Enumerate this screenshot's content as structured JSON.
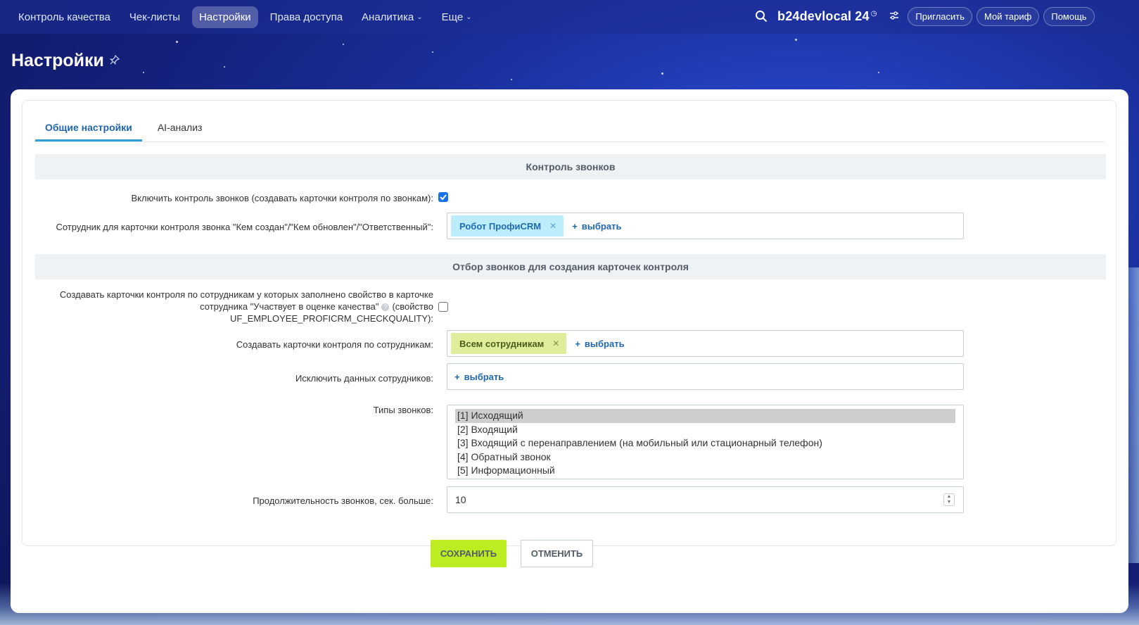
{
  "topbar": {
    "nav": [
      {
        "label": "Контроль качества"
      },
      {
        "label": "Чек-листы"
      },
      {
        "label": "Настройки"
      },
      {
        "label": "Права доступа"
      },
      {
        "label": "Аналитика"
      },
      {
        "label": "Еще"
      }
    ],
    "portal_name": "b24devlocal",
    "portal_suffix": "24",
    "invite_label": "Пригласить",
    "tariff_label": "Мой тариф",
    "help_label": "Помощь"
  },
  "page": {
    "title": "Настройки"
  },
  "tabs": [
    {
      "label": "Общие настройки"
    },
    {
      "label": "AI-анализ"
    }
  ],
  "calls_section": {
    "title": "Контроль звонков",
    "enable_label": "Включить контроль звонков (создавать карточки контроля по звонкам):",
    "enable_checked": true,
    "employee_label": "Сотрудник для карточки контроля звонка \"Кем создан\"/\"Кем обновлен\"/\"Ответственный\":",
    "employee_tag": "Робот ПрофиCRM",
    "select_link": "выбрать"
  },
  "filter_section": {
    "title": "Отбор звонков для создания карточек контроля",
    "property_label_line1": "Создавать карточки контроля по сотрудникам у которых заполнено свойство в карточке",
    "property_label_line2a": "сотрудника \"Участвует в оценке качества\"",
    "property_label_line2b": "(свойство",
    "property_label_line3": "UF_EMPLOYEE_PROFICRM_CHECKQUALITY):",
    "property_checked": false,
    "by_employees_label": "Создавать карточки контроля по сотрудникам:",
    "by_employees_tag": "Всем сотрудникам",
    "exclude_label": "Исключить данных сотрудников:",
    "select_link": "выбрать",
    "call_types_label": "Типы звонков:",
    "call_types": [
      "[1] Исходящий",
      "[2] Входящий",
      "[3] Входящий с перенаправлением (на мобильный или стационарный телефон)",
      "[4] Обратный звонок",
      "[5] Информационный"
    ],
    "call_types_selected": "[1] Исходящий",
    "duration_label": "Продолжительность звонков, сек. больше:",
    "duration_value": "10"
  },
  "actions": {
    "save_label": "СОХРАНИТЬ",
    "cancel_label": "ОТМЕНИТЬ"
  },
  "colors": {
    "accent_blue": "#2066b0",
    "save_green": "#bbed21",
    "tag_blue": "#bcedfc",
    "tag_green": "#dfee9a"
  }
}
